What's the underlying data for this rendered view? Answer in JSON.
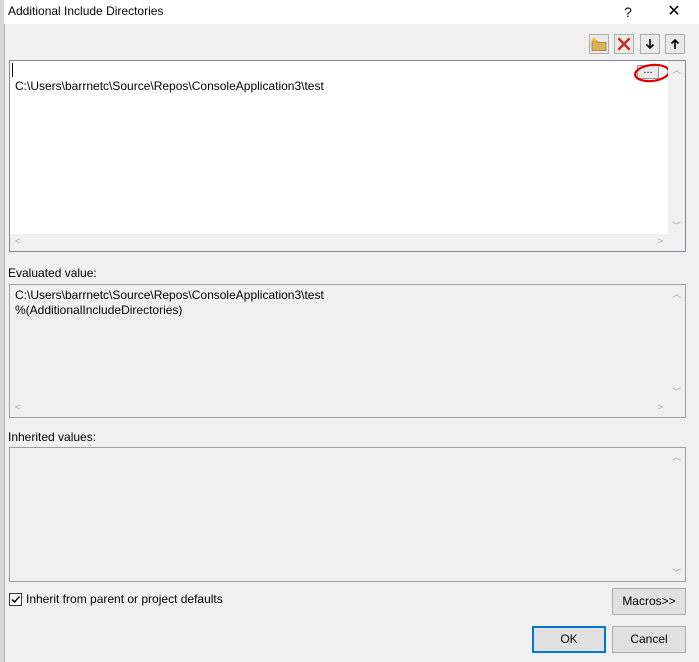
{
  "dialog": {
    "title": "Additional Include Directories",
    "help_glyph": "?",
    "close_glyph": "✕"
  },
  "toolbar": {
    "new_line_icon": "new-folder-icon",
    "delete_icon": "delete-x-icon",
    "move_down_icon": "arrow-down-icon",
    "move_up_icon": "arrow-up-icon",
    "delete_color": "#c42b1c"
  },
  "directories": {
    "entries": [
      "C:\\Users\\barrnetc\\Source\\Repos\\ConsoleApplication3\\test"
    ],
    "browse_label": "...",
    "annotation_color": "#e00000"
  },
  "evaluated": {
    "label": "Evaluated value:",
    "lines": [
      "C:\\Users\\barrnetc\\Source\\Repos\\ConsoleApplication3\\test",
      "%(AdditionalIncludeDirectories)"
    ]
  },
  "inherited": {
    "label": "Inherited values:"
  },
  "inherit_checkbox": {
    "label": "Inherit from parent or project defaults",
    "checked": true
  },
  "buttons": {
    "macros": "Macros>>",
    "ok": "OK",
    "cancel": "Cancel"
  }
}
